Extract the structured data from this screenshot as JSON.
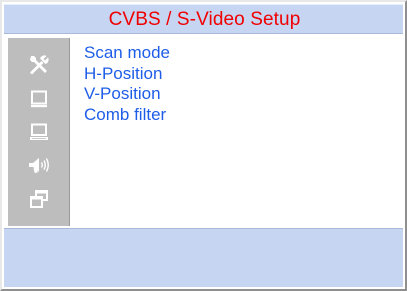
{
  "window": {
    "title": "CVBS / S-Video Setup"
  },
  "sidebar": {
    "icons": [
      {
        "name": "tools-icon"
      },
      {
        "name": "monitor-icon"
      },
      {
        "name": "laptop-icon"
      },
      {
        "name": "speaker-icon"
      },
      {
        "name": "windows-icon"
      }
    ]
  },
  "menu": {
    "items": [
      {
        "label": "Scan mode"
      },
      {
        "label": "H-Position"
      },
      {
        "label": "V-Position"
      },
      {
        "label": "Comb filter"
      }
    ]
  },
  "colors": {
    "title_text": "#f00000",
    "title_bar": "#c6d5f2",
    "menu_text": "#1e5de8",
    "sidebar_bg": "#bdbdbd",
    "icon_fill": "#ffffff"
  }
}
